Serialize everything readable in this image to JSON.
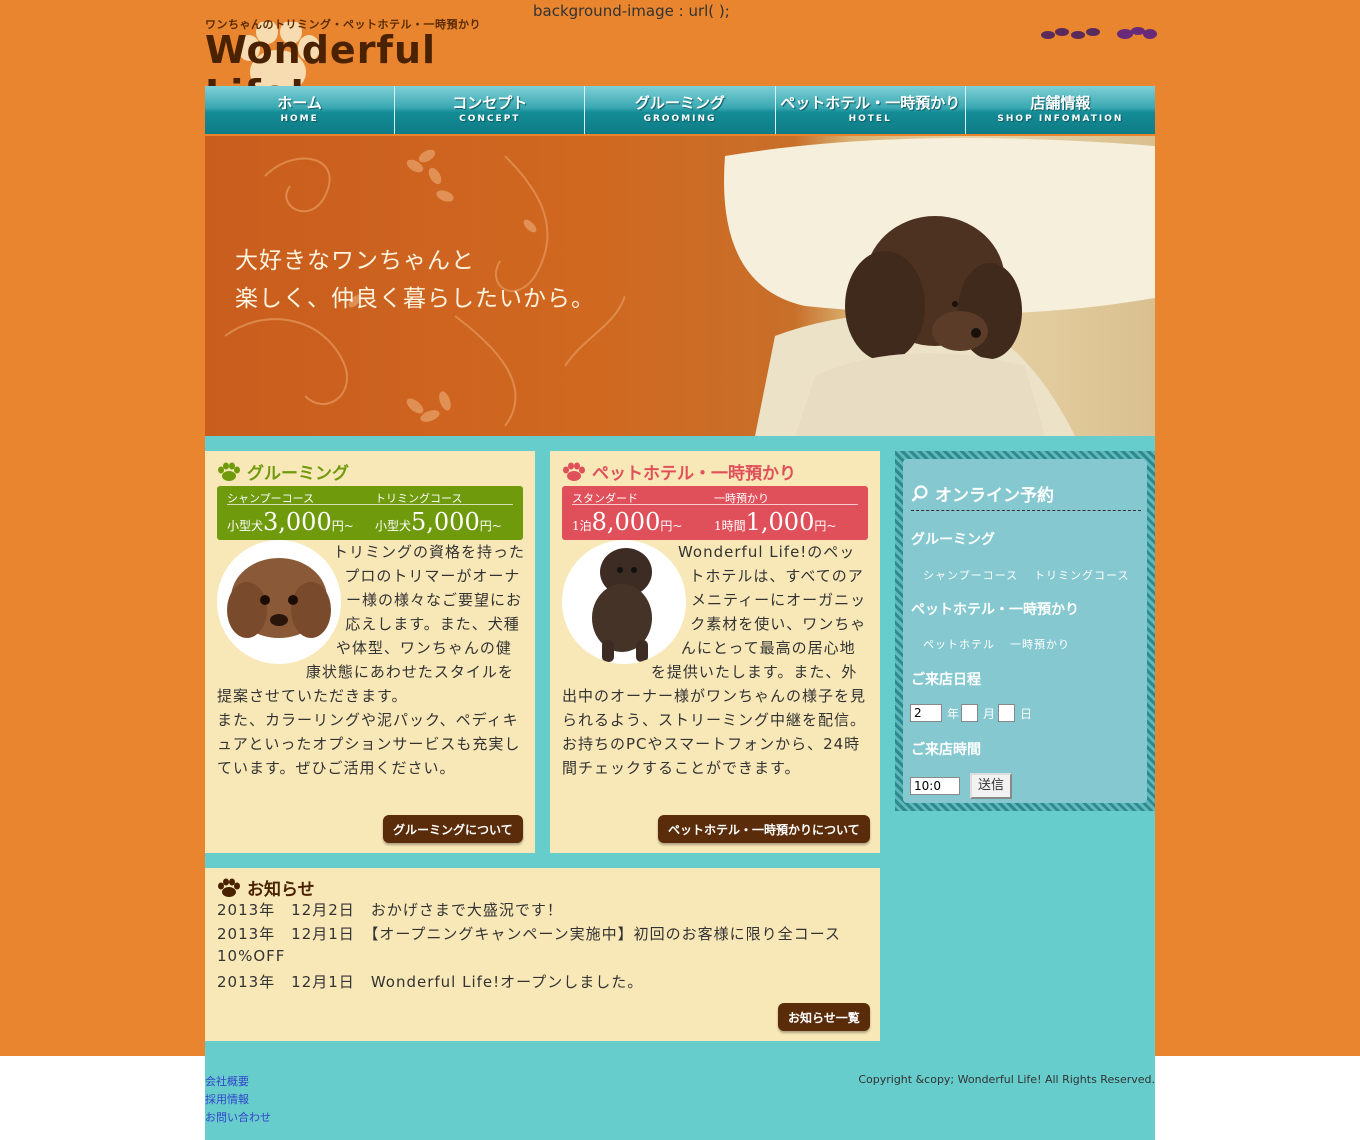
{
  "stray_code": "background-image : url( );",
  "header": {
    "tagline": "ワンちゃんのトリミング・ペットホテル・一時預かり",
    "logo": "Wonderful Life!"
  },
  "nav": [
    {
      "jp": "ホーム",
      "en": "HOME"
    },
    {
      "jp": "コンセプト",
      "en": "CONCEPT"
    },
    {
      "jp": "グルーミング",
      "en": "GROOMING"
    },
    {
      "jp": "ペットホテル・一時預かり",
      "en": "HOTEL"
    },
    {
      "jp": "店舗情報",
      "en": "SHOP INFOMATION"
    }
  ],
  "hero": {
    "line1": "大好きなワンちゃんと",
    "line2": "楽しく、仲良く暮らしたいから。"
  },
  "grooming": {
    "title": "グルーミング",
    "course1_name": "シャンプーコース",
    "course1_prefix": "小型犬",
    "course1_price": "3,000",
    "course1_suffix": "円~",
    "course2_name": "トリミングコース",
    "course2_prefix": "小型犬",
    "course2_price": "5,000",
    "course2_suffix": "円~",
    "body_p1": "トリミングの資格を持ったプロのトリマーがオーナー様の様々なご要望にお応えします。また、犬種や体型、ワンちゃんの健康状態にあわせたスタイルを提案させていただきます。",
    "body_p2": "また、カラーリングや泥パック、ペディキュアといったオプションサービスも充実しています。ぜひご活用ください。",
    "button": "グルーミングについて"
  },
  "hotel": {
    "title": "ペットホテル・一時預かり",
    "course1_name": "スタンダード",
    "course1_prefix": "1泊",
    "course1_price": "8,000",
    "course1_suffix": "円~",
    "course2_name": "一時預かり",
    "course2_prefix": "1時間",
    "course2_price": "1,000",
    "course2_suffix": "円~",
    "body": "Wonderful Life!のペットホテルは、すべてのアメニティーにオーガニック素材を使い、ワンちゃんにとって最高の居心地を提供いたします。また、外出中のオーナー様がワンちゃんの様子を見られるよう、ストリーミング中継を配信。お持ちのPCやスマートフォンから、24時間チェックすることができます。",
    "button": "ペットホテル・一時預かりについて"
  },
  "reservation": {
    "title": "オンライン予約",
    "grooming_heading": "グルーミング",
    "grooming_opt1": "シャンプーコース",
    "grooming_opt2": "トリミングコース",
    "hotel_heading": "ペットホテル・一時預かり",
    "hotel_opt1": "ペットホテル",
    "hotel_opt2": "一時預かり",
    "date_heading": "ご来店日程",
    "year_value": "2",
    "year_label": "年",
    "month_label": "月",
    "day_label": "日",
    "time_heading": "ご来店時間",
    "time_value": "10:0",
    "submit": "送信"
  },
  "news": {
    "title": "お知らせ",
    "items": [
      {
        "date": "2013年　12月2日",
        "text": "おかげさまで大盛況です！"
      },
      {
        "date": "2013年　12月1日",
        "text": "【オープニングキャンペーン実施中】初回のお客様に限り全コース"
      },
      {
        "date": "",
        "text": "10%OFF"
      },
      {
        "date": "2013年　12月1日",
        "text": "Wonderful Life!オープンしました。"
      }
    ],
    "button": "お知らせ一覧"
  },
  "footer": {
    "links": [
      "会社概要",
      "採用情報",
      "お問い合わせ"
    ],
    "copyright": "Copyright &copy; Wonderful Life! All Rights Reserved."
  },
  "colors": {
    "orange": "#e8852e",
    "teal": "#66cccc",
    "cream": "#f8e8b8",
    "grooming_green": "#6e9a0c",
    "hotel_red": "#e0505a",
    "brown": "#5a2c0a"
  }
}
